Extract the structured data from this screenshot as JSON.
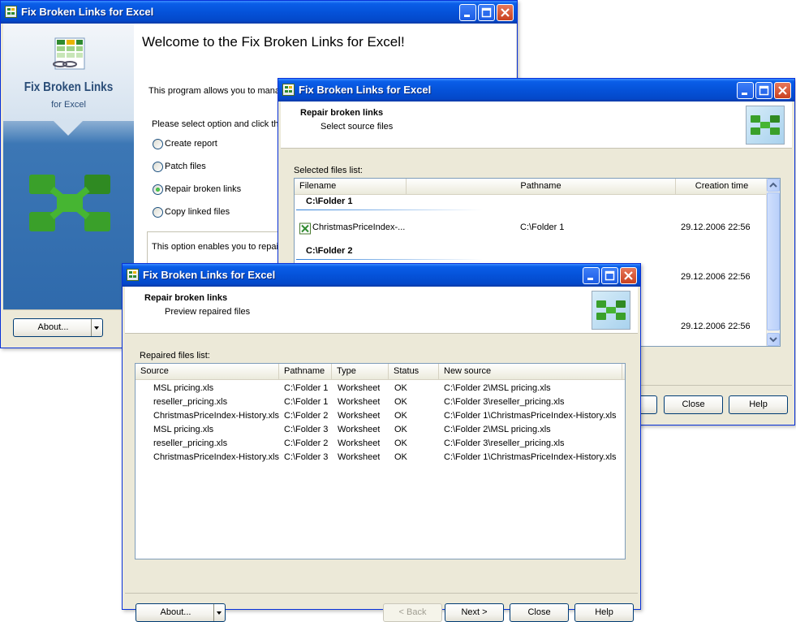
{
  "app_title": "Fix Broken Links for Excel",
  "welcome": {
    "heading": "Welcome to the Fix Broken Links for Excel!",
    "intro": "This program allows you to mana",
    "prompt": "Please select option and click the",
    "options": [
      "Create report",
      "Patch files",
      "Repair broken links",
      "Copy linked files"
    ],
    "selected_option": "Repair broken links",
    "description": "This option enables you to repair",
    "about_label": "About...",
    "logo_line1": "Fix Broken Links",
    "logo_line2": "for Excel"
  },
  "source_dialog": {
    "section_title": "Repair broken links",
    "section_subtitle": "Select source files",
    "list_label": "Selected files list:",
    "columns": [
      "Filename",
      "Pathname",
      "Creation time"
    ],
    "groups": [
      {
        "name": "C:\\Folder 1",
        "file": "ChristmasPriceIndex-...",
        "path": "C:\\Folder 1",
        "time": "29.12.2006 22:56"
      },
      {
        "name": "C:\\Folder 2",
        "file": "",
        "path": "",
        "time": "29.12.2006 22:56"
      },
      {
        "name": "",
        "file": "",
        "path": "",
        "time": "29.12.2006 22:56"
      }
    ],
    "close_label": "Close",
    "help_label": "Help"
  },
  "preview_dialog": {
    "section_title": "Repair broken links",
    "section_subtitle": "Preview repaired files",
    "list_label": "Repaired files list:",
    "columns": [
      "Source",
      "Pathname",
      "Type",
      "Status",
      "New source"
    ],
    "rows": [
      [
        "MSL pricing.xls",
        "C:\\Folder 1",
        "Worksheet",
        "OK",
        "C:\\Folder 2\\MSL pricing.xls"
      ],
      [
        "reseller_pricing.xls",
        "C:\\Folder 1",
        "Worksheet",
        "OK",
        "C:\\Folder 3\\reseller_pricing.xls"
      ],
      [
        "ChristmasPriceIndex-History.xls",
        "C:\\Folder 2",
        "Worksheet",
        "OK",
        "C:\\Folder 1\\ChristmasPriceIndex-History.xls"
      ],
      [
        "MSL pricing.xls",
        "C:\\Folder 3",
        "Worksheet",
        "OK",
        "C:\\Folder 2\\MSL pricing.xls"
      ],
      [
        "reseller_pricing.xls",
        "C:\\Folder 2",
        "Worksheet",
        "OK",
        "C:\\Folder 3\\reseller_pricing.xls"
      ],
      [
        "ChristmasPriceIndex-History.xls",
        "C:\\Folder 3",
        "Worksheet",
        "OK",
        "C:\\Folder 1\\ChristmasPriceIndex-History.xls"
      ]
    ],
    "about_label": "About...",
    "back_label": "< Back",
    "next_label": "Next >",
    "close_label": "Close",
    "help_label": "Help"
  },
  "colors": {
    "titlebar": "#0552d9",
    "window_bg": "#ece9d8",
    "accent_green": "#3aa02a"
  }
}
